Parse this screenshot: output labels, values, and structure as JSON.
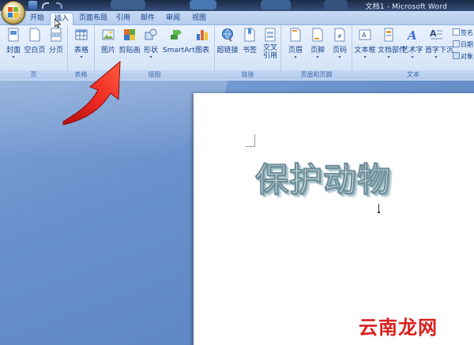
{
  "window": {
    "title": "文档1 - Microsoft Word"
  },
  "tabs": [
    {
      "label": "开始",
      "active": false
    },
    {
      "label": "插入",
      "active": true
    },
    {
      "label": "页面布局",
      "active": false
    },
    {
      "label": "引用",
      "active": false
    },
    {
      "label": "邮件",
      "active": false
    },
    {
      "label": "审阅",
      "active": false
    },
    {
      "label": "视图",
      "active": false
    }
  ],
  "ribbon": {
    "groups": {
      "pages": {
        "label": "页",
        "buttons": [
          "封面",
          "空白页",
          "分页"
        ]
      },
      "tables": {
        "label": "表格",
        "buttons": [
          "表格"
        ]
      },
      "illustrations": {
        "label": "插图",
        "buttons": [
          "图片",
          "剪贴画",
          "形状",
          "SmartArt",
          "图表"
        ]
      },
      "links": {
        "label": "链接",
        "buttons": [
          "超链接",
          "书签",
          "交叉\n引用"
        ]
      },
      "header_footer": {
        "label": "页眉和页脚",
        "buttons": [
          "页眉",
          "页脚",
          "页码"
        ]
      },
      "text": {
        "label": "文本",
        "buttons": [
          "文本框",
          "文档部件",
          "艺术字",
          "首字下沉"
        ],
        "small": [
          "签名",
          "日期",
          "对象"
        ]
      }
    }
  },
  "document": {
    "wordart_text": "保护动物"
  },
  "watermark": {
    "part1": "云南",
    "part2": "龙网"
  },
  "colors": {
    "ribbon_text": "#15428b",
    "accent_arrow": "#e02020",
    "watermark": "#d9201c"
  }
}
